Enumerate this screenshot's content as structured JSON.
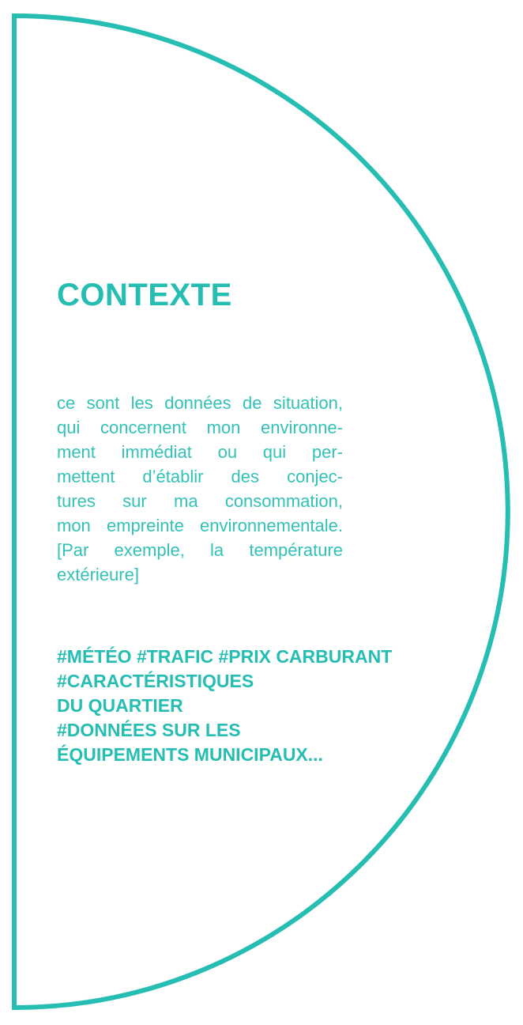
{
  "colors": {
    "accent": "#26bdb2",
    "text": "#33c2b7",
    "background": "#ffffff"
  },
  "title": "CONTEXTE",
  "description_lines": [
    "ce sont les données de situation,",
    "qui concernent mon environne-",
    "ment immédiat ou qui per-",
    "mettent d’établir des conjec-",
    "tures sur ma consommation,",
    "mon empreinte environnementale.",
    "[Par exemple, la température",
    "extérieure]"
  ],
  "tags_lines": [
    "#MÉTÉO #TRAFIC #PRIX CARBURANT",
    "#CARACTÉRISTIQUES",
    "DU QUARTIER",
    "#DONNÉES SUR LES",
    "ÉQUIPEMENTS MUNICIPAUX..."
  ]
}
